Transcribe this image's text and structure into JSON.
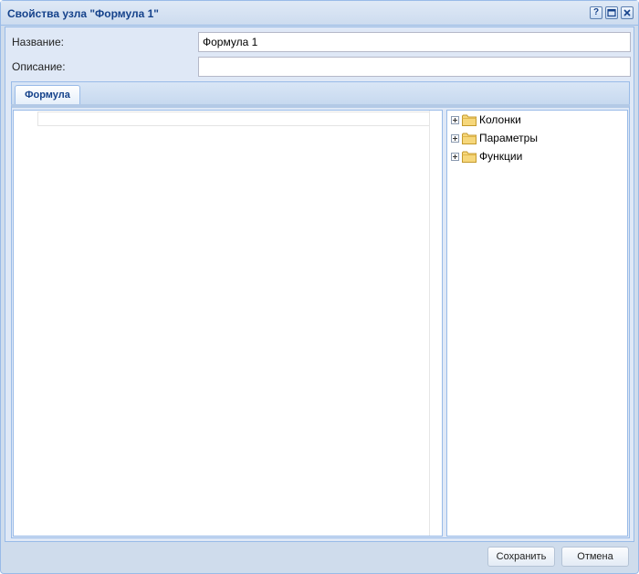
{
  "window": {
    "title": "Свойства узла \"Формула 1\"",
    "tools": {
      "help": "?"
    }
  },
  "form": {
    "name_label": "Название:",
    "name_value": "Формула 1",
    "description_label": "Описание:",
    "description_value": ""
  },
  "tabs": [
    {
      "label": "Формула"
    }
  ],
  "tree": {
    "items": [
      {
        "label": "Колонки",
        "icon": "folder-icon"
      },
      {
        "label": "Параметры",
        "icon": "folder-icon"
      },
      {
        "label": "Функции",
        "icon": "folder-icon"
      }
    ]
  },
  "buttons": {
    "save": "Сохранить",
    "cancel": "Отмена"
  }
}
